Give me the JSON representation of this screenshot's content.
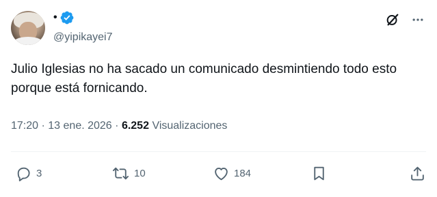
{
  "author": {
    "display_name": "•",
    "handle": "@yipikayei7",
    "verified": true
  },
  "tweet": {
    "text": "Julio Iglesias no ha sacado un comunicado desmintiendo todo esto porque está fornicando."
  },
  "meta": {
    "time": "17:20",
    "separator": "·",
    "date": "13 ene. 2026",
    "separator2": "·",
    "views_count": "6.252",
    "views_label": "Visualizaciones"
  },
  "actions": {
    "replies": "3",
    "reposts": "10",
    "likes": "184"
  },
  "icons": {
    "grok": "grok-icon",
    "more": "more-icon",
    "reply": "reply-icon",
    "repost": "repost-icon",
    "like": "heart-icon",
    "bookmark": "bookmark-icon",
    "share": "share-icon"
  },
  "colors": {
    "verified_blue": "#1d9bf0",
    "text_primary": "#0f1419",
    "text_secondary": "#536471"
  }
}
